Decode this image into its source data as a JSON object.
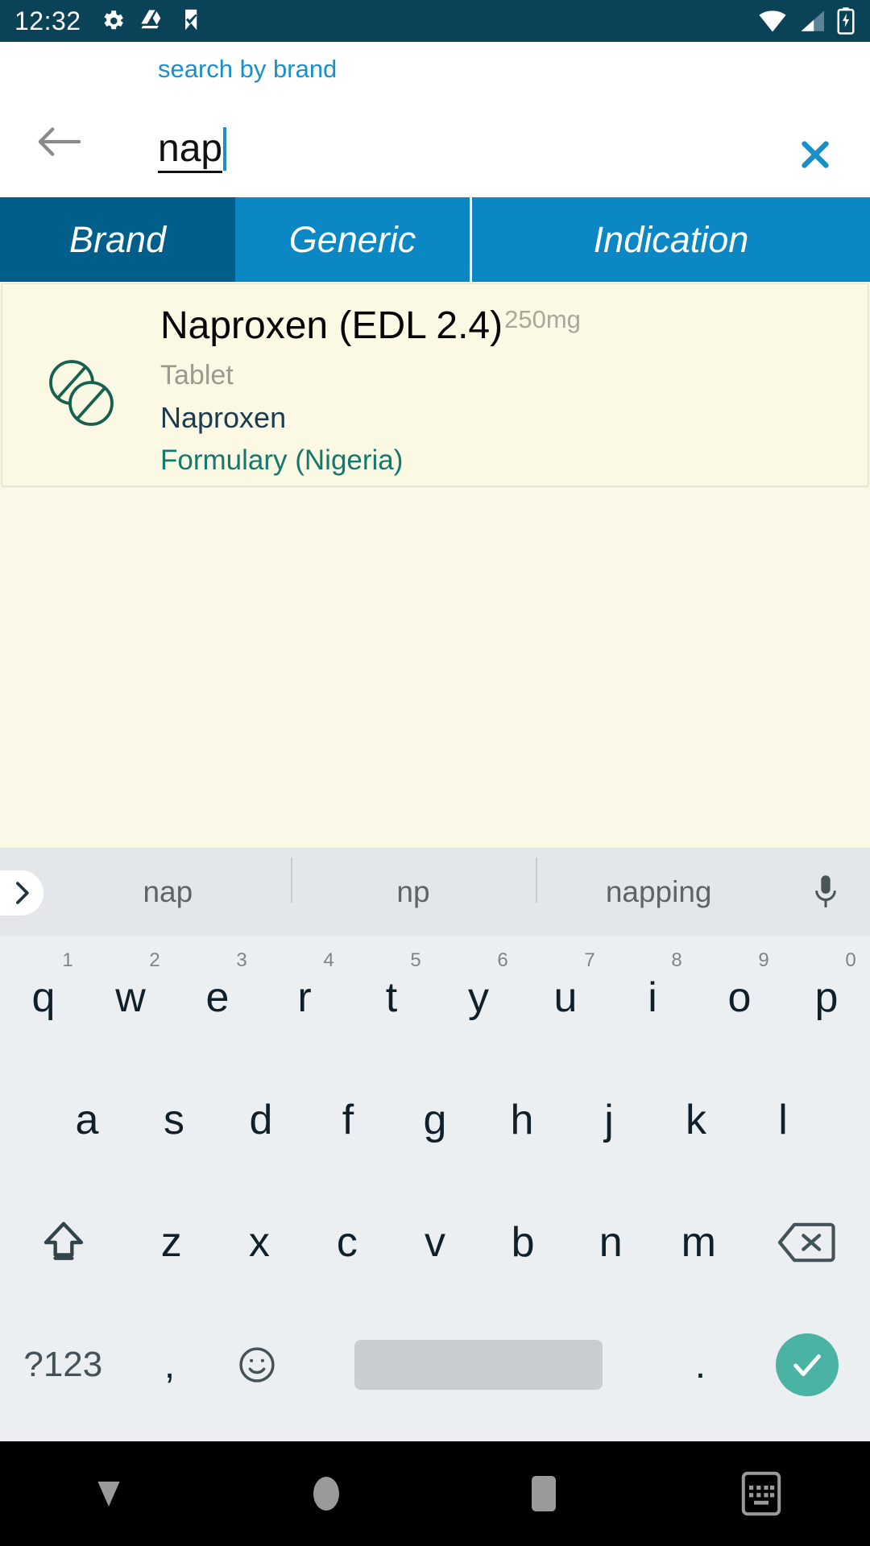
{
  "status_bar": {
    "time": "12:32",
    "left_icons": [
      "gear-icon",
      "google-drive-icon",
      "checkmark-flag-icon"
    ],
    "right_icons": [
      "wifi-icon",
      "cellular-signal-icon",
      "battery-charging-icon"
    ],
    "background_color": "#0a4257"
  },
  "search": {
    "hint_label": "search by brand",
    "value": "nap",
    "placeholder": "search by brand",
    "back_icon": "arrow-left-icon",
    "clear_icon": "close-x-icon",
    "accent_color": "#1a8fc9"
  },
  "tabs": {
    "selected_index": 0,
    "selected_color": "#005e8a",
    "unselected_color": "#0b87c3",
    "items": [
      {
        "label": "Brand"
      },
      {
        "label": "Generic"
      },
      {
        "label": "Indication"
      }
    ]
  },
  "results": {
    "items": [
      {
        "icon": "pill-tablets-icon",
        "title": "Naproxen (EDL 2.4)",
        "strength": "250mg",
        "form": "Tablet",
        "generic": "Naproxen",
        "source": "Formulary (Nigeria)",
        "source_color": "#14796a",
        "card_color": "#fbf8e4"
      }
    ]
  },
  "keyboard": {
    "expand_icon": "chevron-right-icon",
    "mic_icon": "microphone-icon",
    "suggestions": [
      "nap",
      "np",
      "napping"
    ],
    "rows": [
      [
        {
          "key": "q",
          "num": "1"
        },
        {
          "key": "w",
          "num": "2"
        },
        {
          "key": "e",
          "num": "3"
        },
        {
          "key": "r",
          "num": "4"
        },
        {
          "key": "t",
          "num": "5"
        },
        {
          "key": "y",
          "num": "6"
        },
        {
          "key": "u",
          "num": "7"
        },
        {
          "key": "i",
          "num": "8"
        },
        {
          "key": "o",
          "num": "9"
        },
        {
          "key": "p",
          "num": "0"
        }
      ],
      [
        {
          "key": "a"
        },
        {
          "key": "s"
        },
        {
          "key": "d"
        },
        {
          "key": "f"
        },
        {
          "key": "g"
        },
        {
          "key": "h"
        },
        {
          "key": "j"
        },
        {
          "key": "k"
        },
        {
          "key": "l"
        }
      ],
      [
        {
          "key": "z"
        },
        {
          "key": "x"
        },
        {
          "key": "c"
        },
        {
          "key": "v"
        },
        {
          "key": "b"
        },
        {
          "key": "n"
        },
        {
          "key": "m"
        }
      ]
    ],
    "shift_icon": "shift-arrow-icon",
    "backspace_icon": "backspace-icon",
    "symbols_label": "?123",
    "comma_label": ",",
    "emoji_icon": "emoji-smiley-icon",
    "period_label": ".",
    "enter_icon": "checkmark-icon",
    "enter_color": "#4bb3a4",
    "background_color": "#eceff1"
  },
  "nav_bar": {
    "items": [
      "hide-keyboard-down-icon",
      "home-circle-icon",
      "recents-square-icon",
      "switch-keyboard-icon"
    ],
    "background_color": "#000000"
  }
}
